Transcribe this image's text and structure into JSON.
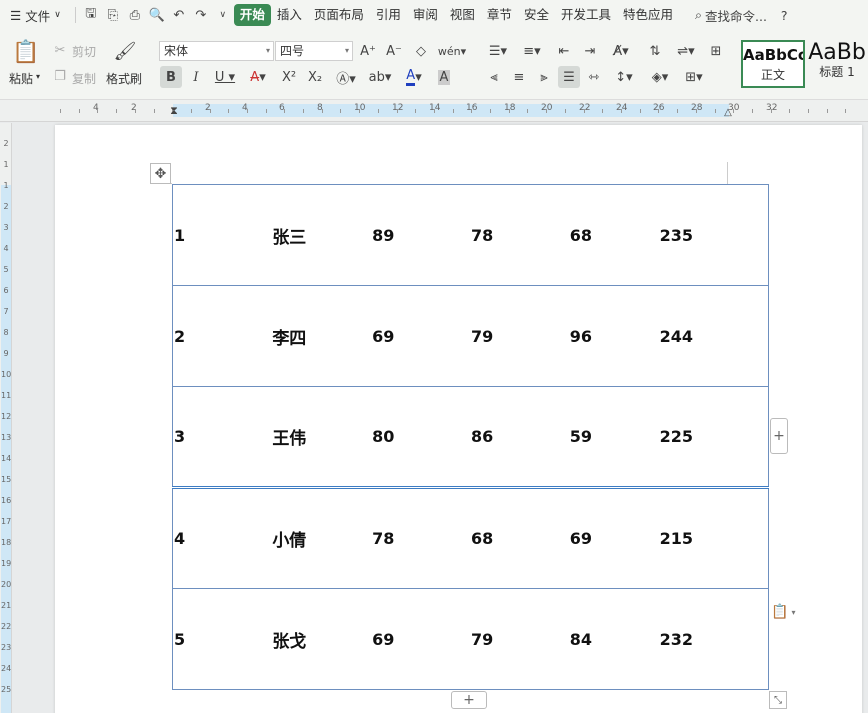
{
  "menu": {
    "file_label": "文件",
    "tabs": [
      "开始",
      "插入",
      "页面布局",
      "引用",
      "审阅",
      "视图",
      "章节",
      "安全",
      "开发工具",
      "特色应用"
    ],
    "active_tab": 0,
    "search_label": "查找命令..."
  },
  "ribbon": {
    "paste_label": "粘贴",
    "cut_label": "剪切",
    "copy_label": "复制",
    "format_painter_label": "格式刷",
    "font_name": "宋体",
    "font_size": "四号",
    "styles": [
      {
        "preview": "AaBbCc",
        "name": "正文"
      },
      {
        "preview": "AaBb",
        "name": "标题 1"
      }
    ]
  },
  "ruler": {
    "h_ticks": [
      "4",
      "2",
      "2",
      "4",
      "6",
      "8",
      "10",
      "12",
      "14",
      "16",
      "18",
      "20",
      "22",
      "24",
      "26",
      "28",
      "30",
      "32"
    ],
    "v_ticks": [
      "2",
      "1",
      "1",
      "2",
      "3",
      "4",
      "5",
      "6",
      "7",
      "8",
      "9",
      "10",
      "11",
      "12",
      "13",
      "14",
      "15",
      "16",
      "17",
      "18",
      "19",
      "20",
      "21",
      "22",
      "23",
      "24",
      "25"
    ]
  },
  "table": {
    "rows": [
      [
        "1",
        "张三",
        "89",
        "78",
        "68",
        "235"
      ],
      [
        "2",
        "李四",
        "69",
        "79",
        "96",
        "244"
      ],
      [
        "3",
        "王伟",
        "80",
        "86",
        "59",
        "225"
      ],
      [
        "4",
        "小倩",
        "78",
        "68",
        "69",
        "215"
      ],
      [
        "5",
        "张戈",
        "69",
        "79",
        "84",
        "232"
      ]
    ]
  },
  "colors": {
    "accent": "#3a8a54",
    "table_border": "#6d8fbf",
    "ruler_track": "#cfe7f6"
  }
}
